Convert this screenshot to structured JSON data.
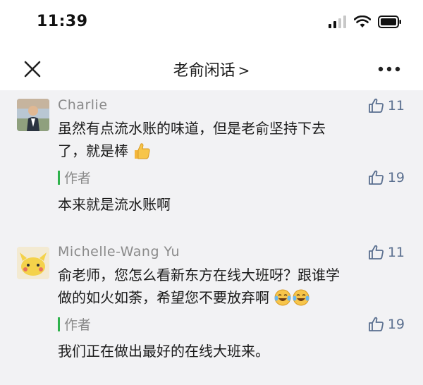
{
  "status_bar": {
    "time": "11:39"
  },
  "nav": {
    "title": "老俞闲话",
    "chevron": ">"
  },
  "comments": [
    {
      "nickname": "Charlie",
      "likes": "11",
      "text_line1": "虽然有点流水账的味道，但是老俞坚持下去",
      "text_line2": "了，就是棒",
      "emoji": "thumbs-up-emoji",
      "reply": {
        "author_label": "作者",
        "likes": "19",
        "text": "本来就是流水账啊"
      }
    },
    {
      "nickname": "Michelle-Wang Yu",
      "likes": "11",
      "text_line1": "俞老师，您怎么看新东方在线大班呀？跟谁学",
      "text_line2": "做的如火如荼，希望您不要放弃啊",
      "emoji": "tears-of-joy-emoji",
      "reply": {
        "author_label": "作者",
        "likes": "19",
        "text": "我们正在做出最好的在线大班来。"
      }
    }
  ],
  "colors": {
    "author_bar": "#2fb24c",
    "like": "#5a6f8f",
    "background": "#f2f2f4"
  }
}
